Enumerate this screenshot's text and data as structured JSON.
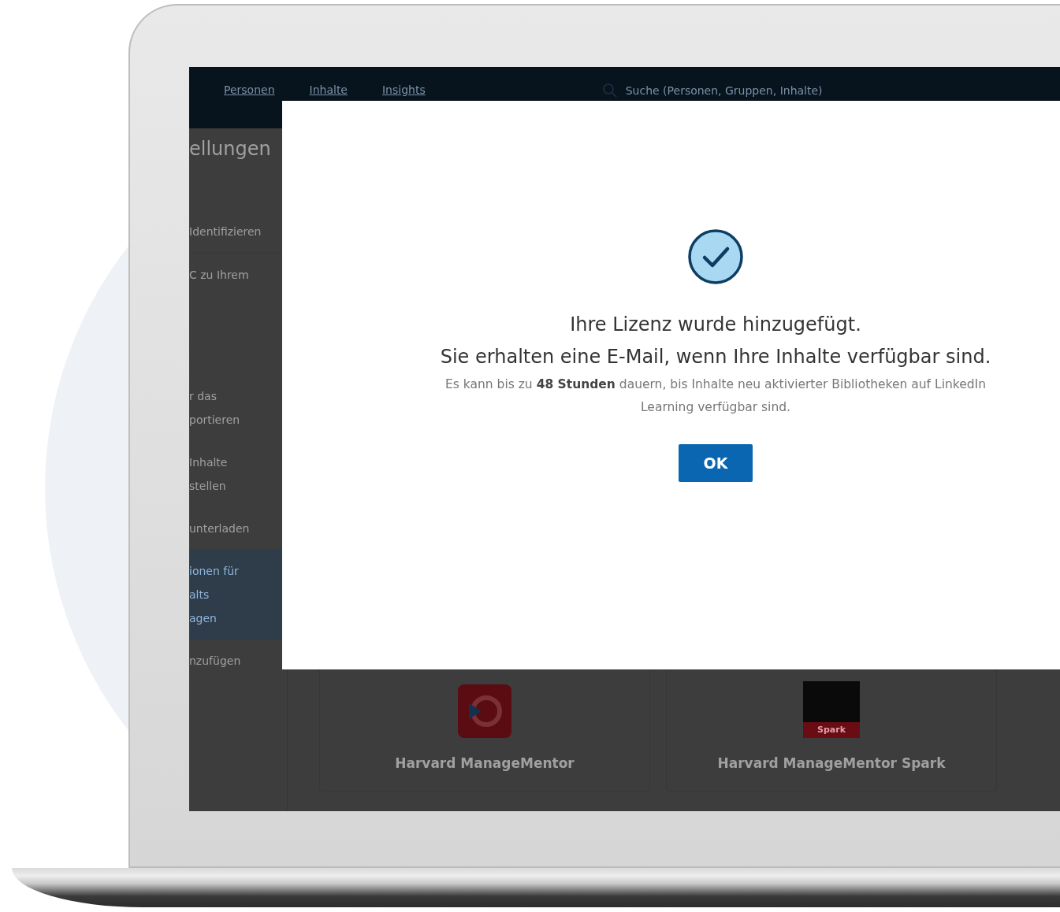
{
  "nav": {
    "items": [
      {
        "label": "Personen"
      },
      {
        "label": "Inhalte"
      },
      {
        "label": "Insights"
      }
    ],
    "search": {
      "placeholder": "Suche (Personen, Gruppen, Inhalte)"
    }
  },
  "page": {
    "title": "ellungen",
    "sidebar": [
      {
        "lines": [
          "Identifizieren"
        ],
        "selected": false,
        "divider": true
      },
      {
        "lines": [
          "C zu Ihrem"
        ],
        "selected": false,
        "divider": false
      },
      {
        "lines": [
          "r das",
          "portieren"
        ],
        "selected": false,
        "divider": false
      },
      {
        "lines": [
          "Inhalte",
          "stellen"
        ],
        "selected": false,
        "divider": false
      },
      {
        "lines": [
          "unterladen"
        ],
        "selected": false,
        "divider": false
      },
      {
        "lines": [
          "ionen für",
          "alts",
          "agen"
        ],
        "selected": true,
        "divider": false
      },
      {
        "lines": [
          "nzufügen"
        ],
        "selected": false,
        "divider": false
      }
    ],
    "cards": [
      {
        "kind": "mentor",
        "title": "Harvard ManageMentor"
      },
      {
        "kind": "spark",
        "title": "Harvard ManageMentor Spark",
        "logo_text": "Spark"
      }
    ]
  },
  "dialog": {
    "title": "Ihre Lizenz wurde hinzugefügt.",
    "message": "Sie erhalten eine E-Mail, wenn Ihre Inhalte verfügbar sind.",
    "note": "Es kann bis zu **48 Stunden** dauern, bis Inhalte neu aktivierter Bibliotheken auf LinkedIn Learning verfügbar sind.",
    "button": "OK"
  }
}
